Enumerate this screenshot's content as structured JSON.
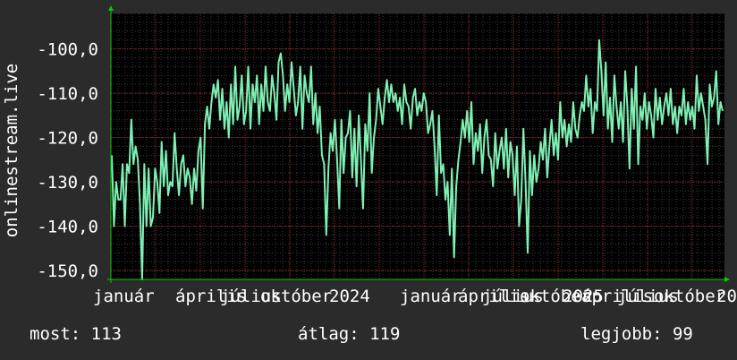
{
  "chart_data": {
    "type": "line",
    "ylabel": "onlinestream.live",
    "ylim": [
      -152,
      -92
    ],
    "y_ticks": [
      -100,
      -110,
      -120,
      -130,
      -140,
      -150
    ],
    "y_tick_labels": [
      "-100,0",
      "-110,0",
      "-120,0",
      "-130,0",
      "-140,0",
      "-150,0"
    ],
    "x_tick_labels": [
      "január",
      "április",
      "július",
      "október",
      "2024",
      "január",
      "április",
      "július",
      "október",
      "2025",
      "április",
      "július",
      "október",
      "20"
    ],
    "grid": true,
    "colors": {
      "line": "#7ff0b4",
      "background": "#000000",
      "grid_minor": "#3a3a3a",
      "grid_major": "#8a2a2a",
      "axis": "#00cc00"
    },
    "series": [
      {
        "values": [
          -124,
          -140,
          -130,
          -134,
          -134,
          -126,
          -140,
          -126,
          -128,
          -116,
          -126,
          -122,
          -125,
          -135,
          -152,
          -126,
          -140,
          -127,
          -140,
          -138,
          -127,
          -130,
          -137,
          -121,
          -131,
          -123,
          -133,
          -130,
          -131,
          -119,
          -127,
          -133,
          -126,
          -124,
          -131,
          -127,
          -129,
          -135,
          -127,
          -132,
          -123,
          -120,
          -136,
          -117,
          -113,
          -118,
          -112,
          -108,
          -111,
          -107,
          -116,
          -109,
          -118,
          -112,
          -120,
          -108,
          -117,
          -104,
          -116,
          -113,
          -106,
          -117,
          -114,
          -104,
          -118,
          -108,
          -112,
          -106,
          -117,
          -108,
          -114,
          -104,
          -112,
          -114,
          -106,
          -110,
          -116,
          -103,
          -101,
          -106,
          -114,
          -108,
          -112,
          -103,
          -109,
          -115,
          -112,
          -104,
          -118,
          -106,
          -110,
          -112,
          -104,
          -117,
          -110,
          -119,
          -113,
          -124,
          -126,
          -142,
          -127,
          -119,
          -123,
          -116,
          -125,
          -136,
          -116,
          -128,
          -120,
          -119,
          -114,
          -129,
          -118,
          -131,
          -115,
          -125,
          -136,
          -117,
          -123,
          -110,
          -128,
          -120,
          -116,
          -109,
          -113,
          -117,
          -111,
          -107,
          -112,
          -108,
          -112,
          -110,
          -114,
          -111,
          -117,
          -108,
          -112,
          -113,
          -118,
          -111,
          -109,
          -115,
          -112,
          -114,
          -110,
          -112,
          -119,
          -117,
          -114,
          -122,
          -133,
          -115,
          -128,
          -126,
          -134,
          -130,
          -142,
          -127,
          -147,
          -131,
          -125,
          -121,
          -116,
          -120,
          -114,
          -121,
          -112,
          -126,
          -119,
          -123,
          -117,
          -128,
          -120,
          -116,
          -124,
          -125,
          -131,
          -119,
          -127,
          -123,
          -120,
          -127,
          -118,
          -129,
          -121,
          -124,
          -133,
          -122,
          -140,
          -134,
          -118,
          -130,
          -146,
          -123,
          -133,
          -124,
          -130,
          -127,
          -121,
          -125,
          -118,
          -129,
          -122,
          -116,
          -124,
          -119,
          -125,
          -112,
          -120,
          -116,
          -122,
          -117,
          -121,
          -112,
          -118,
          -120,
          -115,
          -112,
          -114,
          -106,
          -113,
          -109,
          -119,
          -112,
          -114,
          -98,
          -105,
          -115,
          -103,
          -118,
          -111,
          -121,
          -106,
          -113,
          -118,
          -112,
          -121,
          -105,
          -113,
          -127,
          -109,
          -118,
          -104,
          -126,
          -113,
          -116,
          -110,
          -118,
          -112,
          -115,
          -120,
          -109,
          -116,
          -111,
          -117,
          -113,
          -110,
          -115,
          -109,
          -117,
          -113,
          -119,
          -113,
          -115,
          -109,
          -117,
          -112,
          -116,
          -113,
          -118,
          -106,
          -114,
          -110,
          -113,
          -116,
          -126,
          -108,
          -113,
          -111,
          -105,
          -117,
          -112,
          -114
        ]
      }
    ]
  },
  "stats": {
    "current": "most: 113",
    "average": "átlag: 119",
    "best": "legjobb: 99"
  }
}
